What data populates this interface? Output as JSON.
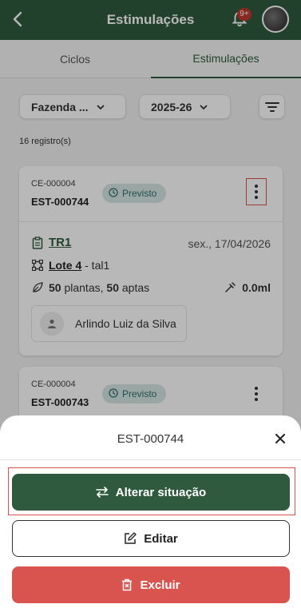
{
  "header": {
    "title": "Estimulações",
    "notification_badge": "9+",
    "bg_color": "#2f5a3e"
  },
  "tabs": [
    {
      "label": "Ciclos",
      "active": false
    },
    {
      "label": "Estimulações",
      "active": true
    }
  ],
  "filters": {
    "farm": "Fazenda ...",
    "season": "2025-26"
  },
  "records_count": "16 registro(s)",
  "cards": [
    {
      "cycle_code": "CE-000004",
      "code": "EST-000744",
      "status": "Previsto",
      "title": "TR1",
      "date": "sex., 17/04/2026",
      "lot": "Lote 4",
      "lot_suffix": " - tal1",
      "plants": "50",
      "plants_label": " plantas, ",
      "apt": "50",
      "apt_label": " aptas",
      "dose": "0.0ml",
      "person": "Arlindo Luiz da Silva"
    },
    {
      "cycle_code": "CE-000004",
      "code": "EST-000743",
      "status": "Previsto"
    }
  ],
  "sheet": {
    "title": "EST-000744",
    "actions": {
      "change_status": "Alterar situação",
      "edit": "Editar",
      "delete": "Excluir"
    },
    "colors": {
      "primary": "#2f5a3e",
      "danger": "#d9534f"
    }
  }
}
